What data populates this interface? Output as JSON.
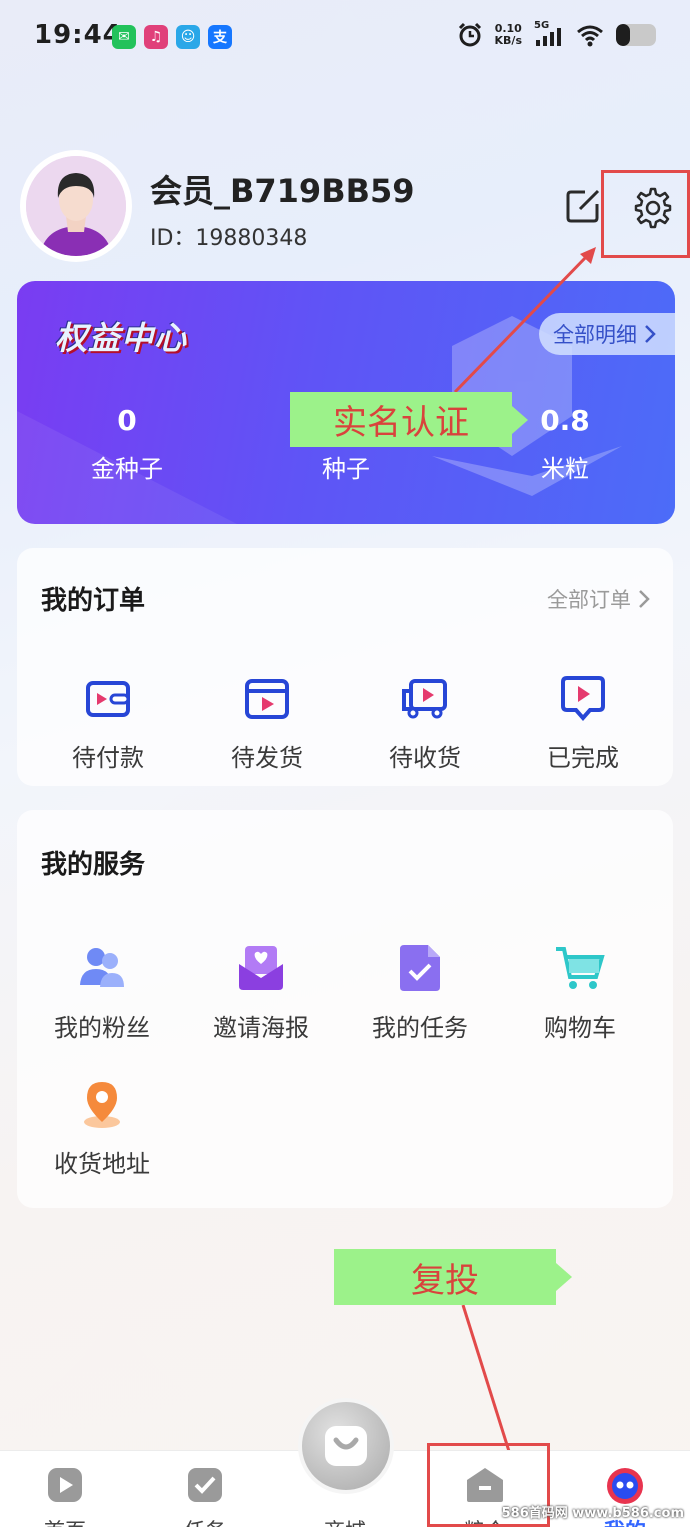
{
  "status_bar": {
    "time": "19:44",
    "apps": [
      {
        "icon": "wechat-icon",
        "glyph": "✉",
        "color": "#22c25b"
      },
      {
        "icon": "music-app-icon",
        "glyph": "♫",
        "color": "#e0407a"
      },
      {
        "icon": "chat-app-icon",
        "glyph": "☺",
        "color": "#2aa7e8"
      },
      {
        "icon": "alipay-icon",
        "glyph": "支",
        "color": "#1677ff"
      }
    ],
    "net_speed_value": "0.10",
    "net_speed_unit": "KB/s",
    "network": "5G",
    "battery_level": 0.35
  },
  "profile": {
    "username": "会员_B719BB59",
    "id_text": "ID：19880348"
  },
  "benefits": {
    "title": "权益中心",
    "detail_label": "全部明细",
    "stats": [
      {
        "value": "0",
        "label": "金种子"
      },
      {
        "value": "",
        "label": "种子"
      },
      {
        "value": "0.8",
        "label": "米粒"
      }
    ]
  },
  "annotations": {
    "real_name": "实名认证",
    "reinvest": "复投",
    "accent": "#e24a4a",
    "tag_color": "#9cf28a"
  },
  "orders": {
    "title": "我的订单",
    "all_label": "全部订单",
    "items": [
      {
        "label": "待付款",
        "icon": "wallet-icon"
      },
      {
        "label": "待发货",
        "icon": "box-icon"
      },
      {
        "label": "待收货",
        "icon": "truck-icon"
      },
      {
        "label": "已完成",
        "icon": "completed-icon"
      }
    ]
  },
  "services": {
    "title": "我的服务",
    "items": [
      {
        "label": "我的粉丝",
        "icon": "fans-icon"
      },
      {
        "label": "邀请海报",
        "icon": "invite-poster-icon"
      },
      {
        "label": "我的任务",
        "icon": "task-icon"
      },
      {
        "label": "购物车",
        "icon": "cart-icon"
      },
      {
        "label": "收货地址",
        "icon": "location-pin-icon"
      }
    ]
  },
  "nav": {
    "items": [
      {
        "label": "首页",
        "icon": "home-play-icon"
      },
      {
        "label": "任务",
        "icon": "task-check-icon"
      },
      {
        "label": "商城",
        "icon": "mall-bag-icon"
      },
      {
        "label": "粮仓",
        "icon": "granary-icon"
      },
      {
        "label": "我的",
        "icon": "profile-face-icon"
      }
    ],
    "active_index": 4,
    "active_color": "#3366ff"
  },
  "watermark": "586首码网 www.b586.com"
}
